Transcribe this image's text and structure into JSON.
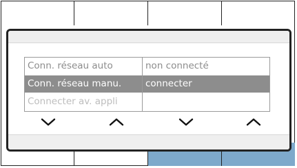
{
  "settings_table": {
    "rows": [
      {
        "label": "Conn. réseau  auto",
        "value": "non connecté",
        "selected": false
      },
      {
        "label": "Conn. réseau manu.",
        "value": "connecter",
        "selected": true
      },
      {
        "label": "Connecter av. appli",
        "value": "",
        "selected": false
      }
    ]
  },
  "navigation": {
    "buttons": [
      "chevron-down-icon",
      "chevron-up-icon",
      "chevron-down-icon",
      "chevron-up-icon"
    ]
  },
  "colors": {
    "selection": "#8d8d8d",
    "active_tab": "#7ea9cb",
    "panel_bar": "#efefef"
  }
}
